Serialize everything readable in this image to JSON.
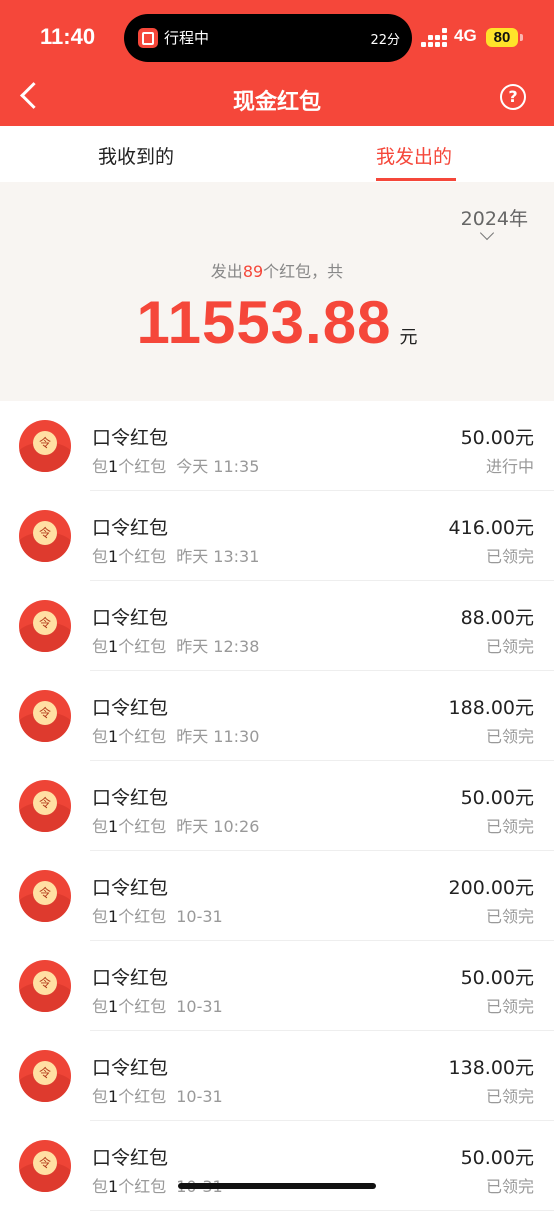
{
  "status_bar": {
    "time": "11:40",
    "island_title": "行程中",
    "island_eta": "22分",
    "network": "4G",
    "battery": "80"
  },
  "header": {
    "title": "现金红包",
    "help_glyph": "?"
  },
  "tabs": [
    {
      "label": "我收到的",
      "active": false
    },
    {
      "label": "我发出的",
      "active": true
    }
  ],
  "summary": {
    "year": "2024年",
    "prefix": "发出",
    "count": "89",
    "suffix": "个红包，共",
    "total": "11553.88",
    "unit": "元"
  },
  "icon_char": "令",
  "records": [
    {
      "title": "口令红包",
      "pre": "包",
      "n": "1",
      "post": "个红包",
      "date": "今天 11:35",
      "amount": "50.00元",
      "status": "进行中"
    },
    {
      "title": "口令红包",
      "pre": "包",
      "n": "1",
      "post": "个红包",
      "date": "昨天 13:31",
      "amount": "416.00元",
      "status": "已领完"
    },
    {
      "title": "口令红包",
      "pre": "包",
      "n": "1",
      "post": "个红包",
      "date": "昨天 12:38",
      "amount": "88.00元",
      "status": "已领完"
    },
    {
      "title": "口令红包",
      "pre": "包",
      "n": "1",
      "post": "个红包",
      "date": "昨天 11:30",
      "amount": "188.00元",
      "status": "已领完"
    },
    {
      "title": "口令红包",
      "pre": "包",
      "n": "1",
      "post": "个红包",
      "date": "昨天 10:26",
      "amount": "50.00元",
      "status": "已领完"
    },
    {
      "title": "口令红包",
      "pre": "包",
      "n": "1",
      "post": "个红包",
      "date": "10-31",
      "amount": "200.00元",
      "status": "已领完"
    },
    {
      "title": "口令红包",
      "pre": "包",
      "n": "1",
      "post": "个红包",
      "date": "10-31",
      "amount": "50.00元",
      "status": "已领完"
    },
    {
      "title": "口令红包",
      "pre": "包",
      "n": "1",
      "post": "个红包",
      "date": "10-31",
      "amount": "138.00元",
      "status": "已领完"
    },
    {
      "title": "口令红包",
      "pre": "包",
      "n": "1",
      "post": "个红包",
      "date": "10-31",
      "amount": "50.00元",
      "status": "已领完"
    }
  ]
}
